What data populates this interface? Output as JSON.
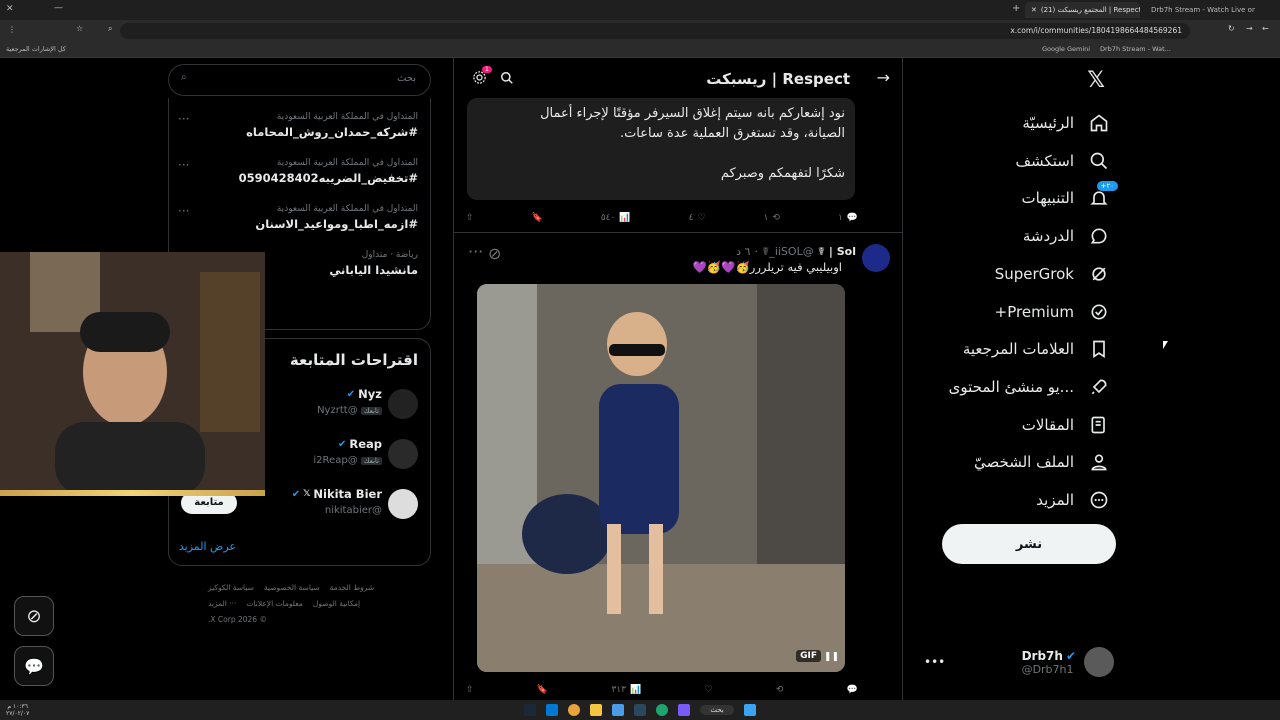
{
  "browser": {
    "tabs": [
      {
        "label": "Drb7h Stream - Watch Live on",
        "active": false
      },
      {
        "label": "(21) المجتمع ريسبكت | Respect / X",
        "active": true
      }
    ],
    "url": "x.com/i/communities/1804198664484569261",
    "bookmarks": {
      "right": [
        "Google Gemini",
        "Drb7h Stream - Wat..."
      ],
      "left": "كل الإشارات المرجعية"
    }
  },
  "nav": {
    "logo": "𝕏",
    "items": [
      {
        "key": "home",
        "label": "الرئيسيّة",
        "icon": "home-icon"
      },
      {
        "key": "explore",
        "label": "استكشف",
        "icon": "search-icon"
      },
      {
        "key": "notifications",
        "label": "التنبيهات",
        "icon": "bell-icon",
        "badge": "٢٠+"
      },
      {
        "key": "chat",
        "label": "الدردشة",
        "icon": "chat-icon"
      },
      {
        "key": "grok",
        "label": "SuperGrok",
        "icon": "grok-icon"
      },
      {
        "key": "premium",
        "label": "Premium+",
        "icon": "verified-icon"
      },
      {
        "key": "bookmarks",
        "label": "العلامات المرجعية",
        "icon": "bookmark-icon"
      },
      {
        "key": "creators",
        "label": "...يو منشئ المحتوى",
        "icon": "rocket-icon"
      },
      {
        "key": "articles",
        "label": "المقالات",
        "icon": "article-icon"
      },
      {
        "key": "profile",
        "label": "الملف الشخصيّ",
        "icon": "person-icon"
      },
      {
        "key": "more",
        "label": "المزيد",
        "icon": "more-circle-icon"
      }
    ],
    "post_button": "نشر",
    "user": {
      "name": "Drb7h",
      "handle": "@Drb7h1"
    }
  },
  "timeline": {
    "title": "Respect | ريسبكت",
    "settings_badge": "1",
    "post1": {
      "text_line1": "نود إشعاركم بانه سيتم إغلاق السيرفر مؤقتًا لإجراء أعمال",
      "text_line2": "الصيانة، وقد تستغرق العملية عدة ساعات.",
      "text_line3": "شكرًا لتفهمكم وصبركم",
      "replies": "١",
      "reposts": "١",
      "likes": "٤",
      "views": "٥٤٠"
    },
    "post2": {
      "name": "Sol | ☤",
      "handle": "@iiSOL_☤",
      "time": "٦ د",
      "text": "اوبيليبي فيه تريلررر🥳💜🥳💜",
      "media_tag": "GIF",
      "views": "٣١٣"
    }
  },
  "sidebar": {
    "search_placeholder": "بحث",
    "trends": [
      {
        "meta": "المتداول في المملكة العربية السعودية",
        "name": "#شركه_حمدان_روش_المحاماه"
      },
      {
        "meta": "المتداول في المملكة العربية السعودية",
        "name": "#تخفيض_الضريبه0590428402"
      },
      {
        "meta": "المتداول في المملكة العربية السعودية",
        "name": "#ازمه_اطبا_ومواعيد_الاسنان"
      },
      {
        "meta": "رياضة · متداول",
        "name": "مانشيدا الياباني"
      }
    ],
    "suggest_title": "اقتراحات المتابعة",
    "suggestions": [
      {
        "name": "Nyz",
        "handle": "@Nyzrtt",
        "followed_label": "تابعك"
      },
      {
        "name": "Reap",
        "handle": "@i2Reap",
        "followed_label": "تابعك"
      },
      {
        "name": "Nikita Bier",
        "handle": "@nikitabier",
        "followed_label": ""
      }
    ],
    "follow_button": "متابعة",
    "show_more": "عرض المزيد",
    "footer": {
      "row1": [
        "شروط الخدمة",
        "سياسة الخصوصية",
        "سياسة الكوكيز"
      ],
      "row2": [
        "إمكانية الوصول",
        "معلومات الإعلانات",
        "··· المزيد"
      ],
      "copyright": "© 2026 X Corp."
    }
  },
  "taskbar": {
    "search": "بحث",
    "time": "١٠:٣٦ م",
    "date": "٢٧/٠٢/٠٧"
  }
}
